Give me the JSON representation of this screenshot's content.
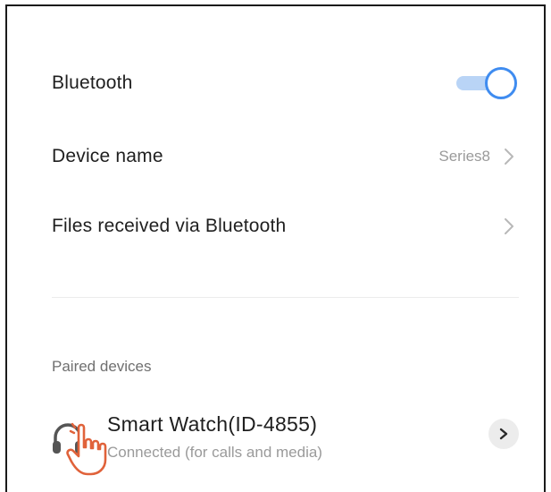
{
  "bluetooth": {
    "label": "Bluetooth",
    "enabled": true
  },
  "device_name": {
    "label": "Device name",
    "value": "Series8"
  },
  "files_received": {
    "label": "Files received via Bluetooth"
  },
  "paired_section": {
    "header": "Paired devices",
    "devices": [
      {
        "name": "Smart Watch(ID-4855)",
        "status": "Connected (for calls and media)",
        "icon": "headphones-icon"
      }
    ]
  },
  "colors": {
    "accent": "#3f8cf0",
    "toggle_track": "#b9d4f6",
    "cursor": "#e0623a"
  }
}
